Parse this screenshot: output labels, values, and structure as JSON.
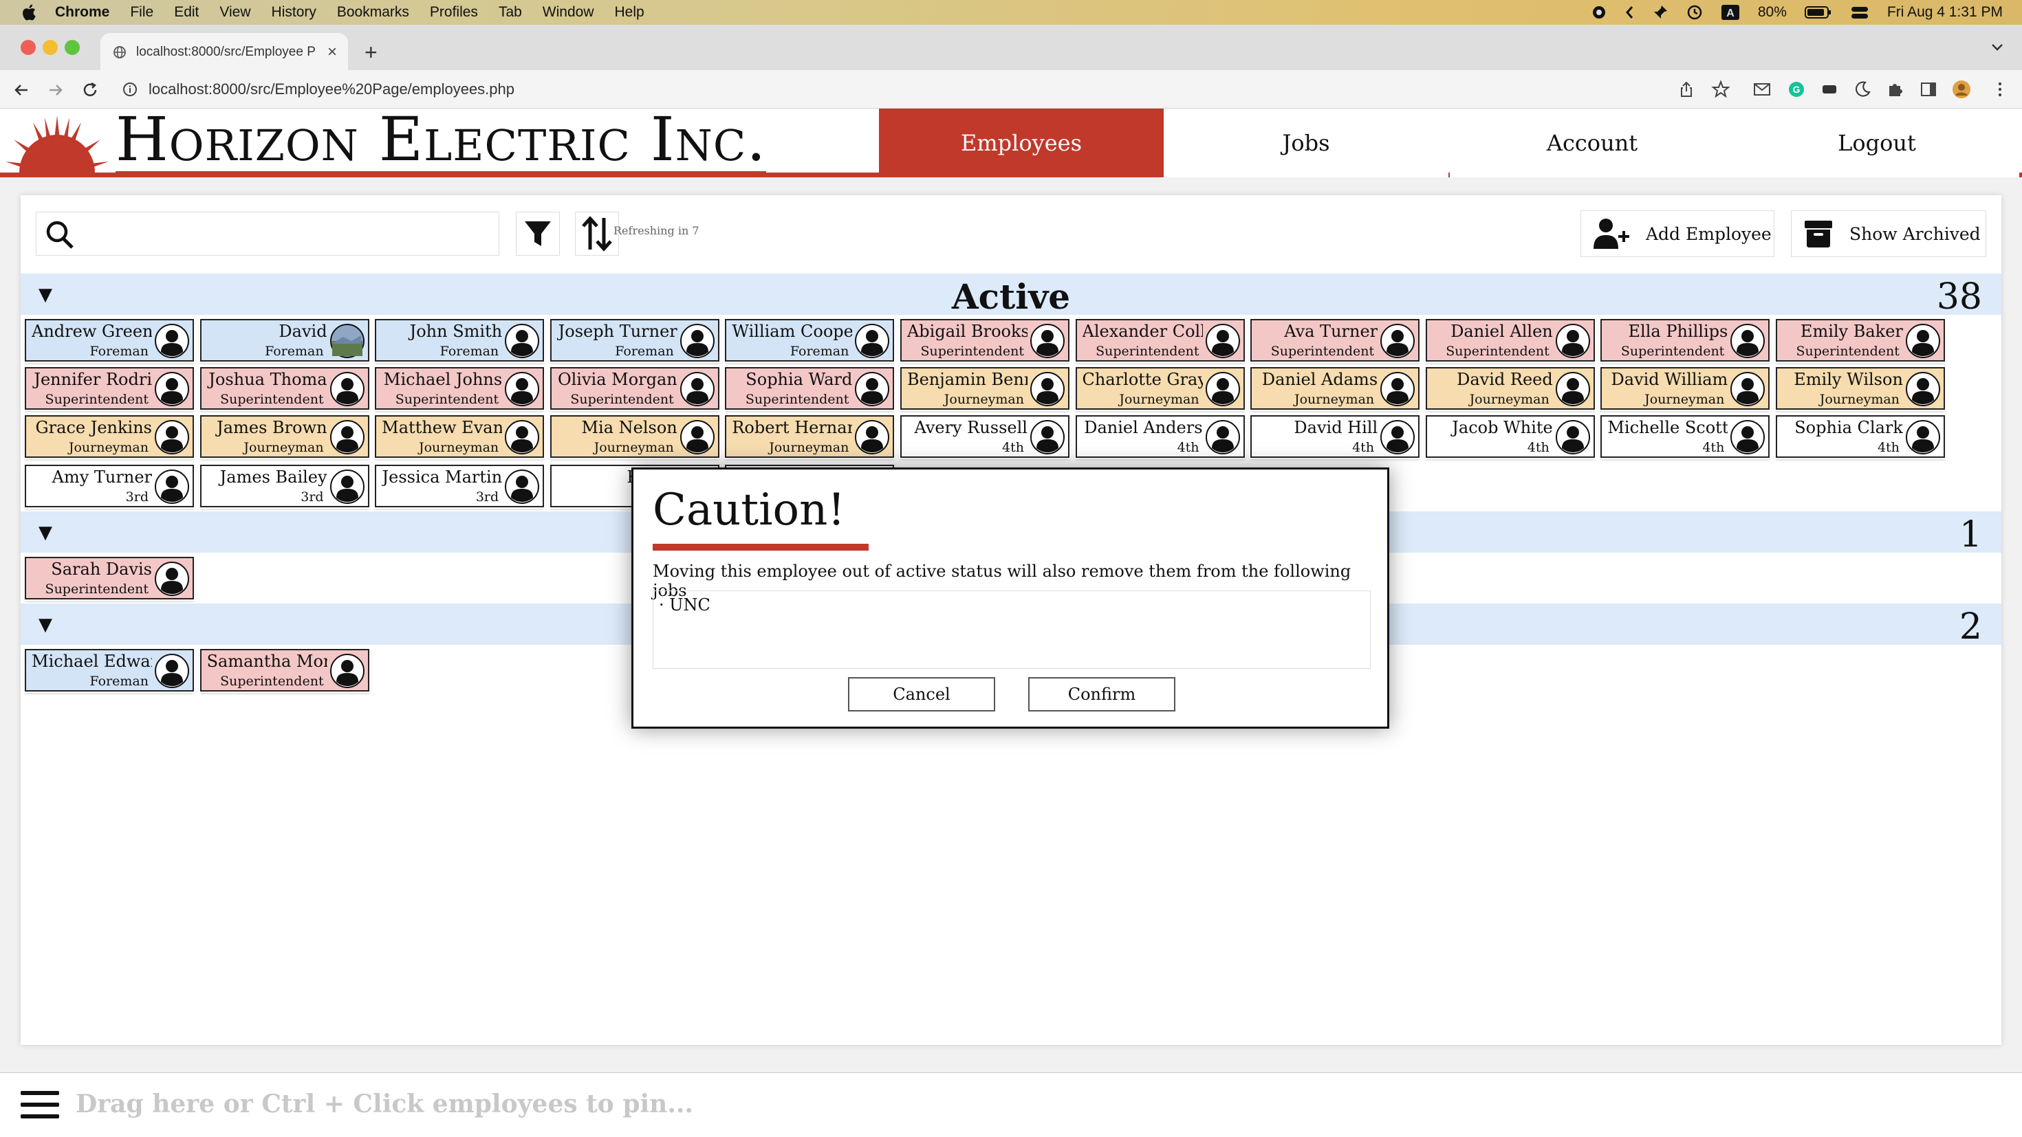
{
  "menubar": {
    "app": "Chrome",
    "items": [
      "File",
      "Edit",
      "View",
      "History",
      "Bookmarks",
      "Profiles",
      "Tab",
      "Window",
      "Help"
    ],
    "battery": "80%",
    "datetime": "Fri Aug 4  1:31 PM"
  },
  "browser": {
    "tab_title": "localhost:8000/src/Employee P",
    "url": "localhost:8000/src/Employee%20Page/employees.php"
  },
  "header": {
    "logo_text": "Horizon Electric Inc.",
    "nav": [
      "Employees",
      "Jobs",
      "Account",
      "Logout"
    ],
    "active_nav": "Employees"
  },
  "toolbar": {
    "search_placeholder": "",
    "refresh_text": "Refreshing in 7",
    "add_employee": "Add Employee",
    "show_archived": "Show Archived"
  },
  "groups": {
    "active": {
      "title": "Active",
      "count": "38"
    },
    "group2": {
      "title": "",
      "count": "1"
    },
    "group3": {
      "title": "",
      "count": "2"
    }
  },
  "active_rows": [
    [
      {
        "name": "Andrew Green",
        "role": "Foreman",
        "type": "f"
      },
      {
        "name": "David",
        "role": "Foreman",
        "type": "f",
        "photo": true
      },
      {
        "name": "John Smith",
        "role": "Foreman",
        "type": "f"
      },
      {
        "name": "Joseph Turner",
        "role": "Foreman",
        "type": "f"
      },
      {
        "name": "William Coope",
        "role": "Foreman",
        "type": "f"
      },
      {
        "name": "Abigail Brooks",
        "role": "Superintendent",
        "type": "s"
      },
      {
        "name": "Alexander Coll",
        "role": "Superintendent",
        "type": "s"
      },
      {
        "name": "Ava Turner",
        "role": "Superintendent",
        "type": "s"
      },
      {
        "name": "Daniel Allen",
        "role": "Superintendent",
        "type": "s"
      },
      {
        "name": "Ella Phillips",
        "role": "Superintendent",
        "type": "s"
      },
      {
        "name": "Emily Baker",
        "role": "Superintendent",
        "type": "s"
      }
    ],
    [
      {
        "name": "Jennifer Rodri",
        "role": "Superintendent",
        "type": "s"
      },
      {
        "name": "Joshua Thoma",
        "role": "Superintendent",
        "type": "s"
      },
      {
        "name": "Michael Johns",
        "role": "Superintendent",
        "type": "s"
      },
      {
        "name": "Olivia Morgan",
        "role": "Superintendent",
        "type": "s"
      },
      {
        "name": "Sophia Ward",
        "role": "Superintendent",
        "type": "s"
      },
      {
        "name": "Benjamin Benr",
        "role": "Journeyman",
        "type": "j"
      },
      {
        "name": "Charlotte Gray",
        "role": "Journeyman",
        "type": "j"
      },
      {
        "name": "Daniel Adams",
        "role": "Journeyman",
        "type": "j"
      },
      {
        "name": "David Reed",
        "role": "Journeyman",
        "type": "j"
      },
      {
        "name": "David William",
        "role": "Journeyman",
        "type": "j"
      },
      {
        "name": "Emily Wilson",
        "role": "Journeyman",
        "type": "j"
      }
    ],
    [
      {
        "name": "Grace Jenkins",
        "role": "Journeyman",
        "type": "j"
      },
      {
        "name": "James Brown",
        "role": "Journeyman",
        "type": "j"
      },
      {
        "name": "Matthew Evan",
        "role": "Journeyman",
        "type": "j"
      },
      {
        "name": "Mia Nelson",
        "role": "Journeyman",
        "type": "j"
      },
      {
        "name": "Robert Hernan",
        "role": "Journeyman",
        "type": "j"
      },
      {
        "name": "Avery Russell",
        "role": "4th",
        "type": "4"
      },
      {
        "name": "Daniel Anders",
        "role": "4th",
        "type": "4"
      },
      {
        "name": "David Hill",
        "role": "4th",
        "type": "4"
      },
      {
        "name": "Jacob White",
        "role": "4th",
        "type": "4"
      },
      {
        "name": "Michelle Scott",
        "role": "4th",
        "type": "4"
      },
      {
        "name": "Sophia Clark",
        "role": "4th",
        "type": "4"
      }
    ],
    [
      {
        "name": "Amy Turner",
        "role": "3rd",
        "type": "4"
      },
      {
        "name": "James Bailey",
        "role": "3rd",
        "type": "4"
      },
      {
        "name": "Jessica Martin",
        "role": "3rd",
        "type": "4"
      },
      {
        "name": "Karen",
        "role": "",
        "type": "4"
      },
      {
        "name": "",
        "role": "",
        "type": "4"
      }
    ]
  ],
  "group2_cards": [
    {
      "name": "Sarah Davis",
      "role": "Superintendent",
      "type": "s"
    }
  ],
  "group3_cards": [
    {
      "name": "Michael Edwar",
      "role": "Foreman",
      "type": "f"
    },
    {
      "name": "Samantha Mor",
      "role": "Superintendent",
      "type": "s"
    }
  ],
  "modal": {
    "title": "Caution!",
    "message": "Moving this employee out of active status will also remove them from the following jobs",
    "jobs": [
      "UNC"
    ],
    "cancel": "Cancel",
    "confirm": "Confirm"
  },
  "pinbar": {
    "placeholder": "Drag here or Ctrl + Click employees to pin..."
  },
  "colors": {
    "brand_red": "#c0392b",
    "foreman": "#d3e4f6",
    "superintendent": "#f4c7c7",
    "journeyman": "#f6dcae",
    "apprentice": "#ffffff"
  }
}
